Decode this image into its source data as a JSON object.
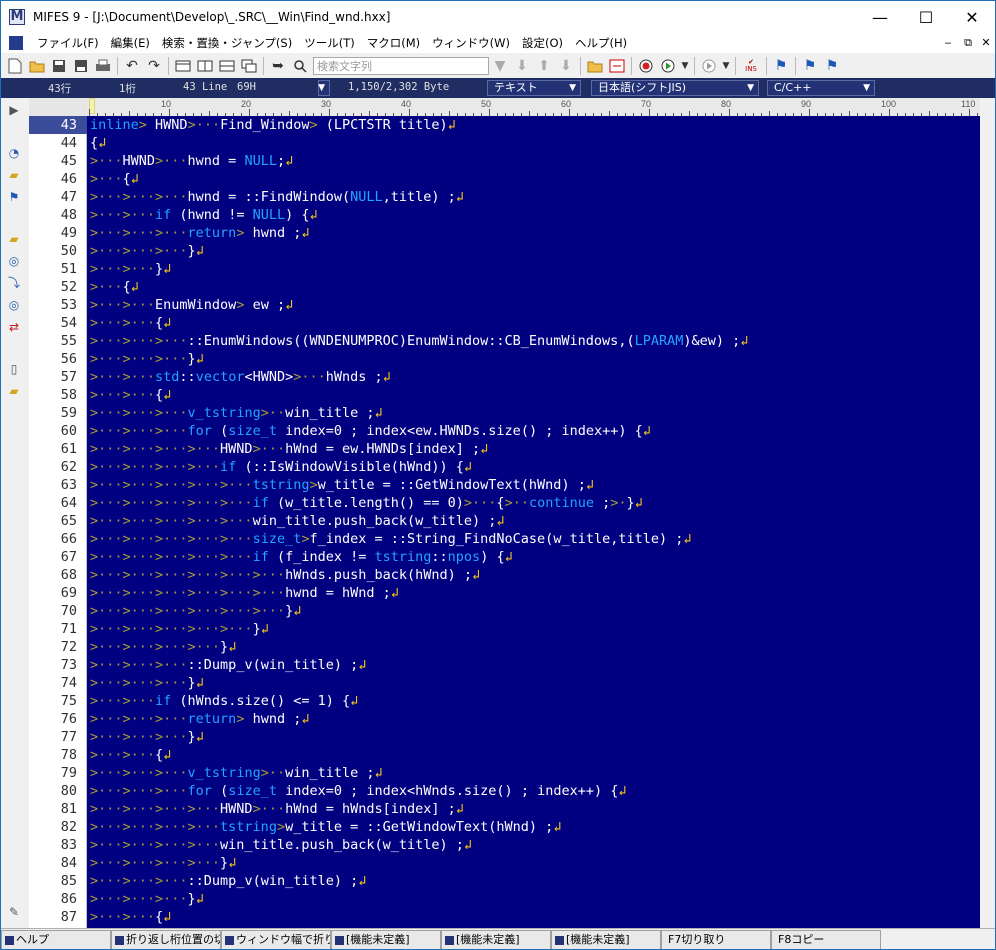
{
  "window": {
    "title": "MIFES 9 - [J:\\Document\\Develop\\_.SRC\\__Win\\Find_wnd.hxx]",
    "app_icon_letter": "M",
    "controls": {
      "minimize": "—",
      "maximize": "☐",
      "close": "✕"
    }
  },
  "menu": {
    "items": [
      "ファイル(F)",
      "編集(E)",
      "検索・置換・ジャンプ(S)",
      "ツール(T)",
      "マクロ(M)",
      "ウィンドウ(W)",
      "設定(O)",
      "ヘルプ(H)"
    ],
    "mdi_controls": [
      "‒",
      "⧉",
      "✕"
    ]
  },
  "toolbar": {
    "search_placeholder": "検索文字列",
    "icons": [
      "new-file-icon",
      "open-folder-icon",
      "save-icon",
      "save-all-icon",
      "print-icon",
      "undo-icon",
      "redo-icon",
      "layout-icon",
      "split-icon",
      "tile-icon",
      "cascade-icon",
      "jump-icon",
      "search-icon",
      "ins-icon",
      "flag-icon"
    ],
    "ins_label": "INS"
  },
  "status": {
    "line_col": "43行",
    "column": "1桁",
    "line_label": "43 Line",
    "char_code": "69H",
    "bytes": "1,150/2,302 Byte",
    "mode": "テキスト",
    "encoding": "日本語(シフトJIS)",
    "language": "C/C++"
  },
  "ruler": {
    "marks": [
      "10",
      "20",
      "30",
      "40",
      "50",
      "60",
      "70",
      "80",
      "90",
      "100",
      "110"
    ]
  },
  "editor": {
    "current_line": "43",
    "colors": {
      "background": "#000080",
      "text": "#ffffff",
      "keyword": "#22a4ff",
      "indent_marker": "#aa9a3a",
      "newline_marker": "#f5c518"
    },
    "lines": [
      {
        "no": "43",
        "segs": [
          [
            "kw",
            "inline"
          ],
          [
            "ind",
            "> "
          ],
          [
            "",
            "HWND"
          ],
          [
            "ind",
            ">···"
          ],
          [
            "",
            "Find_Window"
          ],
          [
            "ind",
            "> "
          ],
          [
            "",
            "(LPCTSTR title)"
          ],
          [
            "nl",
            "↲"
          ]
        ]
      },
      {
        "no": "44",
        "segs": [
          [
            "",
            "{"
          ],
          [
            "nl",
            "↲"
          ]
        ]
      },
      {
        "no": "45",
        "segs": [
          [
            "ind",
            ">···"
          ],
          [
            "",
            "HWND"
          ],
          [
            "ind",
            ">···"
          ],
          [
            "",
            "hwnd = "
          ],
          [
            "kw",
            "NULL"
          ],
          [
            "",
            ";"
          ],
          [
            "nl",
            "↲"
          ]
        ]
      },
      {
        "no": "46",
        "segs": [
          [
            "ind",
            ">···"
          ],
          [
            "",
            "{"
          ],
          [
            "nl",
            "↲"
          ]
        ]
      },
      {
        "no": "47",
        "segs": [
          [
            "ind",
            ">···>···>···"
          ],
          [
            "",
            "hwnd = ::FindWindow("
          ],
          [
            "kw",
            "NULL"
          ],
          [
            "",
            ",title) ;"
          ],
          [
            "nl",
            "↲"
          ]
        ]
      },
      {
        "no": "48",
        "segs": [
          [
            "ind",
            ">···>···"
          ],
          [
            "kw",
            "if"
          ],
          [
            "",
            " (hwnd != "
          ],
          [
            "kw",
            "NULL"
          ],
          [
            "",
            ") {"
          ],
          [
            "nl",
            "↲"
          ]
        ]
      },
      {
        "no": "49",
        "segs": [
          [
            "ind",
            ">···>···>···"
          ],
          [
            "kw",
            "return"
          ],
          [
            "ind",
            ">"
          ],
          [
            "",
            " hwnd ;"
          ],
          [
            "nl",
            "↲"
          ]
        ]
      },
      {
        "no": "50",
        "segs": [
          [
            "ind",
            ">···>···>···"
          ],
          [
            "",
            "}"
          ],
          [
            "nl",
            "↲"
          ]
        ]
      },
      {
        "no": "51",
        "segs": [
          [
            "ind",
            ">···>···"
          ],
          [
            "",
            "}"
          ],
          [
            "nl",
            "↲"
          ]
        ]
      },
      {
        "no": "52",
        "segs": [
          [
            "ind",
            ">···"
          ],
          [
            "",
            "{"
          ],
          [
            "nl",
            "↲"
          ]
        ]
      },
      {
        "no": "53",
        "segs": [
          [
            "ind",
            ">···>···"
          ],
          [
            "",
            "EnumWindow"
          ],
          [
            "ind",
            "> "
          ],
          [
            "",
            "ew ;"
          ],
          [
            "nl",
            "↲"
          ]
        ]
      },
      {
        "no": "54",
        "segs": [
          [
            "ind",
            ">···>···"
          ],
          [
            "",
            "{"
          ],
          [
            "nl",
            "↲"
          ]
        ]
      },
      {
        "no": "55",
        "segs": [
          [
            "ind",
            ">···>···>···"
          ],
          [
            "",
            "::EnumWindows((WNDENUMPROC)EnumWindow::CB_EnumWindows,("
          ],
          [
            "kw",
            "LPARAM"
          ],
          [
            "",
            ")&ew) ;"
          ],
          [
            "nl",
            "↲"
          ]
        ]
      },
      {
        "no": "56",
        "segs": [
          [
            "ind",
            ">···>···>···"
          ],
          [
            "",
            "}"
          ],
          [
            "nl",
            "↲"
          ]
        ]
      },
      {
        "no": "57",
        "segs": [
          [
            "ind",
            ">···>···"
          ],
          [
            "kw",
            "std"
          ],
          [
            "",
            "::"
          ],
          [
            "kw",
            "vector"
          ],
          [
            "",
            "<HWND>"
          ],
          [
            "ind",
            ">···"
          ],
          [
            "",
            "hWnds ;"
          ],
          [
            "nl",
            "↲"
          ]
        ]
      },
      {
        "no": "58",
        "segs": [
          [
            "ind",
            ">···>···"
          ],
          [
            "",
            "{"
          ],
          [
            "nl",
            "↲"
          ]
        ]
      },
      {
        "no": "59",
        "segs": [
          [
            "ind",
            ">···>···>···"
          ],
          [
            "kw",
            "v_tstring"
          ],
          [
            "ind",
            ">··"
          ],
          [
            "",
            "win_title ;"
          ],
          [
            "nl",
            "↲"
          ]
        ]
      },
      {
        "no": "60",
        "segs": [
          [
            "ind",
            ">···>···>···"
          ],
          [
            "kw",
            "for"
          ],
          [
            "",
            " ("
          ],
          [
            "kw",
            "size_t"
          ],
          [
            "",
            " index=0 ; index<ew.HWNDs.size() ; index++) {"
          ],
          [
            "nl",
            "↲"
          ]
        ]
      },
      {
        "no": "61",
        "segs": [
          [
            "ind",
            ">···>···>···>···"
          ],
          [
            "",
            "HWND"
          ],
          [
            "ind",
            ">···"
          ],
          [
            "",
            "hWnd = ew.HWNDs[index] ;"
          ],
          [
            "nl",
            "↲"
          ]
        ]
      },
      {
        "no": "62",
        "segs": [
          [
            "ind",
            ">···>···>···>···"
          ],
          [
            "kw",
            "if"
          ],
          [
            "",
            " (::IsWindowVisible(hWnd)) {"
          ],
          [
            "nl",
            "↲"
          ]
        ]
      },
      {
        "no": "63",
        "segs": [
          [
            "ind",
            ">···>···>···>···>···"
          ],
          [
            "kw",
            "tstring"
          ],
          [
            "ind",
            ">"
          ],
          [
            "",
            "w_title = ::GetWindowText(hWnd) ;"
          ],
          [
            "nl",
            "↲"
          ]
        ]
      },
      {
        "no": "64",
        "segs": [
          [
            "ind",
            ">···>···>···>···>···"
          ],
          [
            "kw",
            "if"
          ],
          [
            "",
            " (w_title.length() == 0)"
          ],
          [
            "ind",
            ">···"
          ],
          [
            "",
            "{"
          ],
          [
            "ind",
            ">··"
          ],
          [
            "kw",
            "continue"
          ],
          [
            "",
            " ;"
          ],
          [
            "ind",
            ">·"
          ],
          [
            "",
            "}"
          ],
          [
            "nl",
            "↲"
          ]
        ]
      },
      {
        "no": "65",
        "segs": [
          [
            "ind",
            ">···>···>···>···>···"
          ],
          [
            "",
            "win_title.push_back(w_title) ;"
          ],
          [
            "nl",
            "↲"
          ]
        ]
      },
      {
        "no": "66",
        "segs": [
          [
            "ind",
            ">···>···>···>···>···"
          ],
          [
            "kw",
            "size_t"
          ],
          [
            "ind",
            ">"
          ],
          [
            "",
            "f_index = ::String_FindNoCase(w_title,title) ;"
          ],
          [
            "nl",
            "↲"
          ]
        ]
      },
      {
        "no": "67",
        "segs": [
          [
            "ind",
            ">···>···>···>···>···"
          ],
          [
            "kw",
            "if"
          ],
          [
            "",
            " (f_index != "
          ],
          [
            "kw",
            "tstring"
          ],
          [
            "",
            "::"
          ],
          [
            "kw",
            "npos"
          ],
          [
            "",
            ") {"
          ],
          [
            "nl",
            "↲"
          ]
        ]
      },
      {
        "no": "68",
        "segs": [
          [
            "ind",
            ">···>···>···>···>···>···"
          ],
          [
            "",
            "hWnds.push_back(hWnd) ;"
          ],
          [
            "nl",
            "↲"
          ]
        ]
      },
      {
        "no": "69",
        "segs": [
          [
            "ind",
            ">···>···>···>···>···>···"
          ],
          [
            "",
            "hwnd = hWnd ;"
          ],
          [
            "nl",
            "↲"
          ]
        ]
      },
      {
        "no": "70",
        "segs": [
          [
            "ind",
            ">···>···>···>···>···>···"
          ],
          [
            "",
            "}"
          ],
          [
            "nl",
            "↲"
          ]
        ]
      },
      {
        "no": "71",
        "segs": [
          [
            "ind",
            ">···>···>···>···>···"
          ],
          [
            "",
            "}"
          ],
          [
            "nl",
            "↲"
          ]
        ]
      },
      {
        "no": "72",
        "segs": [
          [
            "ind",
            ">···>···>···>···"
          ],
          [
            "",
            "}"
          ],
          [
            "nl",
            "↲"
          ]
        ]
      },
      {
        "no": "73",
        "segs": [
          [
            "ind",
            ">···>···>···"
          ],
          [
            "",
            "::Dump_v(win_title) ;"
          ],
          [
            "nl",
            "↲"
          ]
        ]
      },
      {
        "no": "74",
        "segs": [
          [
            "ind",
            ">···>···>···"
          ],
          [
            "",
            "}"
          ],
          [
            "nl",
            "↲"
          ]
        ]
      },
      {
        "no": "75",
        "segs": [
          [
            "ind",
            ">···>···"
          ],
          [
            "kw",
            "if"
          ],
          [
            "",
            " (hWnds.size() <= 1) {"
          ],
          [
            "nl",
            "↲"
          ]
        ]
      },
      {
        "no": "76",
        "segs": [
          [
            "ind",
            ">···>···>···"
          ],
          [
            "kw",
            "return"
          ],
          [
            "ind",
            ">"
          ],
          [
            "",
            " hwnd ;"
          ],
          [
            "nl",
            "↲"
          ]
        ]
      },
      {
        "no": "77",
        "segs": [
          [
            "ind",
            ">···>···>···"
          ],
          [
            "",
            "}"
          ],
          [
            "nl",
            "↲"
          ]
        ]
      },
      {
        "no": "78",
        "segs": [
          [
            "ind",
            ">···>···"
          ],
          [
            "",
            "{"
          ],
          [
            "nl",
            "↲"
          ]
        ]
      },
      {
        "no": "79",
        "segs": [
          [
            "ind",
            ">···>···>···"
          ],
          [
            "kw",
            "v_tstring"
          ],
          [
            "ind",
            ">··"
          ],
          [
            "",
            "win_title ;"
          ],
          [
            "nl",
            "↲"
          ]
        ]
      },
      {
        "no": "80",
        "segs": [
          [
            "ind",
            ">···>···>···"
          ],
          [
            "kw",
            "for"
          ],
          [
            "",
            " ("
          ],
          [
            "kw",
            "size_t"
          ],
          [
            "",
            " index=0 ; index<hWnds.size() ; index++) {"
          ],
          [
            "nl",
            "↲"
          ]
        ]
      },
      {
        "no": "81",
        "segs": [
          [
            "ind",
            ">···>···>···>···"
          ],
          [
            "",
            "HWND"
          ],
          [
            "ind",
            ">···"
          ],
          [
            "",
            "hWnd = hWnds[index] ;"
          ],
          [
            "nl",
            "↲"
          ]
        ]
      },
      {
        "no": "82",
        "segs": [
          [
            "ind",
            ">···>···>···>···"
          ],
          [
            "kw",
            "tstring"
          ],
          [
            "ind",
            ">"
          ],
          [
            "",
            "w_title = ::GetWindowText(hWnd) ;"
          ],
          [
            "nl",
            "↲"
          ]
        ]
      },
      {
        "no": "83",
        "segs": [
          [
            "ind",
            ">···>···>···>···"
          ],
          [
            "",
            "win_title.push_back(w_title) ;"
          ],
          [
            "nl",
            "↲"
          ]
        ]
      },
      {
        "no": "84",
        "segs": [
          [
            "ind",
            ">···>···>···>···"
          ],
          [
            "",
            "}"
          ],
          [
            "nl",
            "↲"
          ]
        ]
      },
      {
        "no": "85",
        "segs": [
          [
            "ind",
            ">···>···>···"
          ],
          [
            "",
            "::Dump_v(win_title) ;"
          ],
          [
            "nl",
            "↲"
          ]
        ]
      },
      {
        "no": "86",
        "segs": [
          [
            "ind",
            ">···>···>···"
          ],
          [
            "",
            "}"
          ],
          [
            "nl",
            "↲"
          ]
        ]
      },
      {
        "no": "87",
        "segs": [
          [
            "ind",
            ">···>···"
          ],
          [
            "",
            "{"
          ],
          [
            "nl",
            "↲"
          ]
        ]
      }
    ]
  },
  "function_keys": [
    "ヘルプ",
    "折り返し桁位置の切",
    "ウィンドウ幅で折り返し",
    "[機能未定義]",
    "[機能未定義]",
    "[機能未定義]",
    "F7切り取り",
    "F8コピー"
  ]
}
